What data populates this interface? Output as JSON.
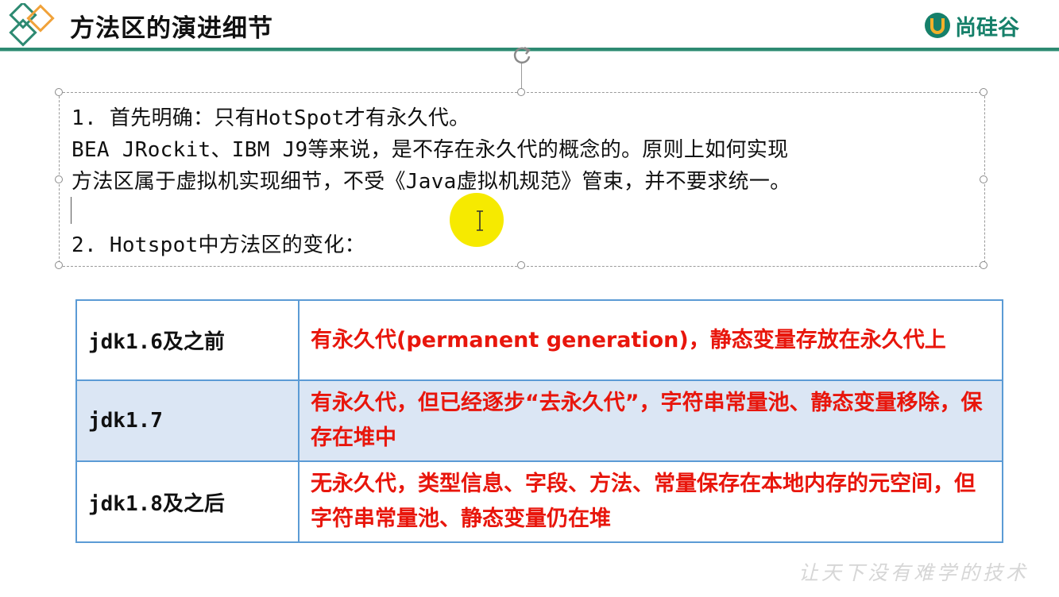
{
  "header": {
    "title": "方法区的演进细节",
    "brand_name": "尚硅谷",
    "accent_color": "#2e8a72"
  },
  "textbox": {
    "line1": "1. 首先明确：只有HotSpot才有永久代。",
    "line2": "BEA JRockit、IBM J9等来说，是不存在永久代的概念的。原则上如何实现",
    "line3": "方法区属于虚拟机实现细节，不受《Java虚拟机规范》管束，并不要求统一。",
    "line4": "",
    "line5": "2. Hotspot中方法区的变化："
  },
  "table": {
    "rows": [
      {
        "version": "jdk1.6及之前",
        "description": "有永久代(permanent generation)，静态变量存放在永久代上"
      },
      {
        "version": "jdk1.7",
        "description": "有永久代，但已经逐步“去永久代”，字符串常量池、静态变量移除，保存在堆中"
      },
      {
        "version": "jdk1.8及之后",
        "description": "无永久代，类型信息、字段、方法、常量保存在本地内存的元空间，但字符串常量池、静态变量仍在堆"
      }
    ],
    "border_color": "#5b9bd5",
    "alt_row_color": "#dbe6f4",
    "description_color": "#e8160c"
  },
  "watermark": "让天下没有难学的技术"
}
